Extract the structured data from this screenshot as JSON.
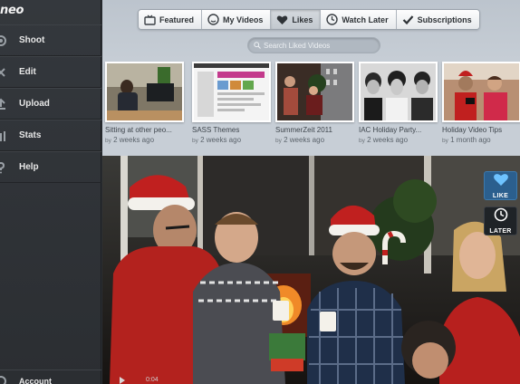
{
  "brand": {
    "logo_text": "neo"
  },
  "sidebar": {
    "items": [
      {
        "label": "Shoot",
        "icon": "gear-icon"
      },
      {
        "label": "Edit",
        "icon": "scissors-icon"
      },
      {
        "label": "Upload",
        "icon": "upload-icon"
      },
      {
        "label": "Stats",
        "icon": "stats-icon"
      },
      {
        "label": "Help",
        "icon": "question-icon"
      }
    ],
    "account_label": "Account"
  },
  "tabs": [
    {
      "label": "Featured",
      "icon": "tv-icon",
      "active": false
    },
    {
      "label": "My Videos",
      "icon": "smiley-icon",
      "active": false
    },
    {
      "label": "Likes",
      "icon": "heart-icon",
      "active": true
    },
    {
      "label": "Watch Later",
      "icon": "clock-icon",
      "active": false
    },
    {
      "label": "Subscriptions",
      "icon": "checkmark-icon",
      "active": false
    }
  ],
  "search": {
    "placeholder": "Search Liked Videos"
  },
  "videos": [
    {
      "title": "Sitting at other peo...",
      "by": "by",
      "age": "2 weeks ago"
    },
    {
      "title": "SASS Themes",
      "by": "by",
      "age": "2 weeks ago"
    },
    {
      "title": "SummerZeit 2011",
      "by": "by",
      "age": "2 weeks ago"
    },
    {
      "title": "IAC Holiday Party...",
      "by": "by",
      "age": "2 weeks ago"
    },
    {
      "title": "Holiday Video Tips",
      "by": "by",
      "age": "1 month ago"
    }
  ],
  "player": {
    "like_label": "LIKE",
    "later_label": "LATER",
    "time_text": "0:04"
  },
  "colors": {
    "sidebar_bg": "#2f3338",
    "main_bg": "#c4ccd4",
    "like_blue": "#2b5f8e",
    "santa_red": "#c0201f"
  }
}
